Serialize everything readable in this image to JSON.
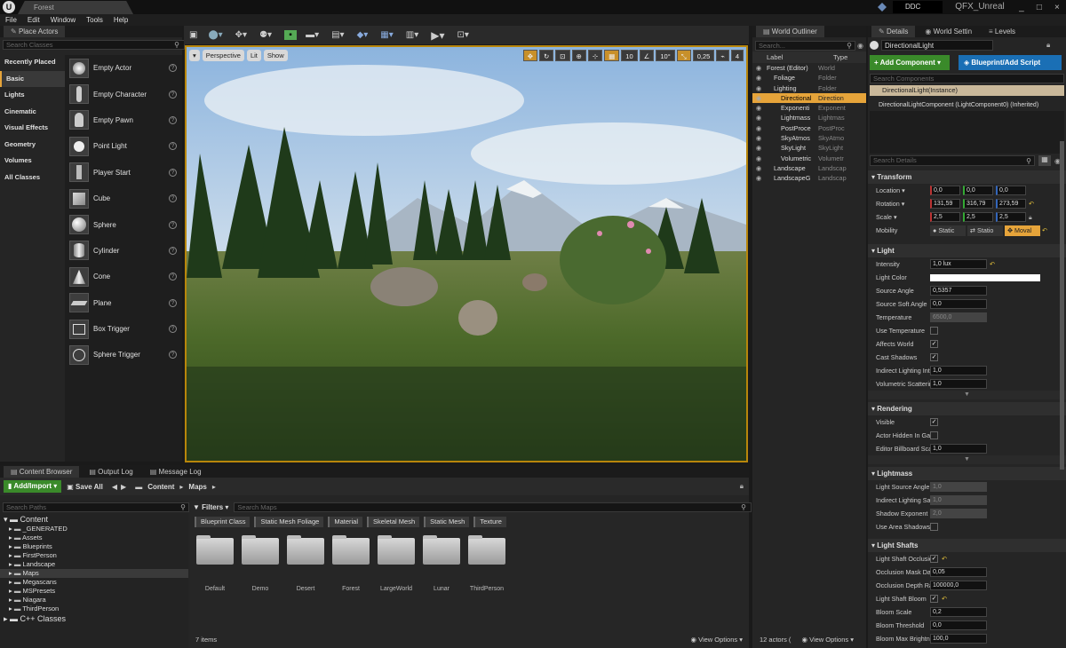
{
  "title_bar": {
    "map_tab": "Forest",
    "ddc": "DDC",
    "project": "QFX_Unreal",
    "controls": [
      "_",
      "□",
      "×"
    ]
  },
  "menu": [
    "File",
    "Edit",
    "Window",
    "Tools",
    "Help"
  ],
  "place_actors": {
    "tab": "Place Actors",
    "search_placeholder": "Search Classes",
    "categories": [
      "Recently Placed",
      "Basic",
      "Lights",
      "Cinematic",
      "Visual Effects",
      "Geometry",
      "Volumes",
      "All Classes"
    ],
    "actors": [
      "Empty Actor",
      "Empty Character",
      "Empty Pawn",
      "Point Light",
      "Player Start",
      "Cube",
      "Sphere",
      "Cylinder",
      "Cone",
      "Plane",
      "Box Trigger",
      "Sphere Trigger"
    ],
    "help": "?"
  },
  "viewport": {
    "perspective": "Perspective",
    "lit": "Lit",
    "show": "Show",
    "grid": "10",
    "rot": "10°",
    "scale": "0,25",
    "cams": "4",
    "icons": [
      "select-icon",
      "translate-icon",
      "mode-landscape-icon",
      "save-icon",
      "source-control-icon",
      "green-mode-icon",
      "marketplace-icon",
      "settings-icon",
      "blueprints-icon",
      "cinematics-icon",
      "build-icon",
      "play-icon",
      "launch-icon"
    ]
  },
  "outliner": {
    "tab": "World Outliner",
    "search_placeholder": "Search...",
    "col_label": "Label",
    "col_type": "Type",
    "rows": [
      {
        "label": "Forest (Editor)",
        "type": "World"
      },
      {
        "label": "Foliage",
        "type": "Folder"
      },
      {
        "label": "Lighting",
        "type": "Folder"
      },
      {
        "label": "Directional",
        "type": "Direction"
      },
      {
        "label": "Exponenti",
        "type": "Exponent"
      },
      {
        "label": "Lightmass",
        "type": "Lightmas"
      },
      {
        "label": "PostProce",
        "type": "PostProc"
      },
      {
        "label": "SkyAtmos",
        "type": "SkyAtmo"
      },
      {
        "label": "SkyLight",
        "type": "SkyLight"
      },
      {
        "label": "Volumetric",
        "type": "Volumetr"
      },
      {
        "label": "Landscape",
        "type": "Landscap"
      },
      {
        "label": "LandscapeG",
        "type": "Landscap"
      }
    ],
    "footer": "12 actors (",
    "view_options": "View Options"
  },
  "details": {
    "tabs": [
      "Details",
      "World Settin",
      "Levels"
    ],
    "name": "DirectionalLight",
    "add_component": "+ Add Component",
    "blueprint": "Blueprint/Add Script",
    "search_components": "Search Components",
    "instance": "DirectionalLight(Instance)",
    "component": "DirectionalLightComponent (LightComponent0) (Inherited)",
    "search_details": "Search Details",
    "transform": {
      "title": "Transform",
      "location_label": "Location",
      "location": [
        "0,0",
        "0,0",
        "0,0"
      ],
      "rotation_label": "Rotation",
      "rotation": [
        "131,59",
        "316,79",
        "273,59"
      ],
      "scale_label": "Scale",
      "scale": [
        "2,5",
        "2,5",
        "2,5"
      ],
      "mobility_label": "Mobility",
      "mobility": [
        "Static",
        "Statio",
        "Moval"
      ]
    },
    "light": {
      "title": "Light",
      "intensity_label": "Intensity",
      "intensity": "1,0 lux",
      "color_label": "Light Color",
      "source_angle_label": "Source Angle",
      "source_angle": "0,5357",
      "source_soft_label": "Source Soft Angle",
      "source_soft": "0,0",
      "temperature_label": "Temperature",
      "temperature": "6500,0",
      "use_temp_label": "Use Temperature",
      "affects_label": "Affects World",
      "cast_label": "Cast Shadows",
      "indirect_label": "Indirect Lighting Inte",
      "indirect": "1,0",
      "volumetric_label": "Volumetric Scatterin",
      "volumetric": "1,0"
    },
    "rendering": {
      "title": "Rendering",
      "visible_label": "Visible",
      "hidden_label": "Actor Hidden In Gam",
      "billboard_label": "Editor Billboard Scal",
      "billboard": "1,0"
    },
    "lightmass": {
      "title": "Lightmass",
      "lsa_label": "Light Source Angle",
      "lsa": "1,0",
      "ils_label": "Indirect Lighting Satu",
      "ils": "1,0",
      "se_label": "Shadow Exponent",
      "se": "2,0",
      "uas_label": "Use Area Shadows fo"
    },
    "shafts": {
      "title": "Light Shafts",
      "occ_label": "Light Shaft Occlusio",
      "omd_label": "Occlusion Mask Dar",
      "omd": "0,05",
      "odr_label": "Occlusion Depth Ran",
      "odr": "100000,0",
      "bloom_label": "Light Shaft Bloom",
      "bs_label": "Bloom Scale",
      "bs": "0,2",
      "bt_label": "Bloom Threshold",
      "bt": "0,0",
      "bmb_label": "Bloom Max Brightne",
      "bmb": "100,0"
    }
  },
  "content_browser": {
    "tabs": [
      "Content Browser",
      "Output Log",
      "Message Log"
    ],
    "add_import": "Add/Import",
    "save_all": "Save All",
    "path": [
      "Content",
      "Maps"
    ],
    "search_paths": "Search Paths",
    "filters": "Filters",
    "search_maps": "Search Maps",
    "tree_root": "Content",
    "tree": [
      "_GENERATED",
      "Assets",
      "Blueprints",
      "FirstPerson",
      "Landscape",
      "Maps",
      "Megascans",
      "MSPresets",
      "Niagara",
      "ThirdPerson"
    ],
    "cpp": "C++ Classes",
    "filter_chips": [
      "Blueprint Class",
      "Static Mesh Foliage",
      "Material",
      "Skeletal Mesh",
      "Static Mesh",
      "Texture"
    ],
    "folders": [
      "Default",
      "Demo",
      "Desert",
      "Forest",
      "LargeWorld",
      "Lunar",
      "ThirdPerson"
    ],
    "items": "7 items",
    "view_options": "View Options"
  }
}
